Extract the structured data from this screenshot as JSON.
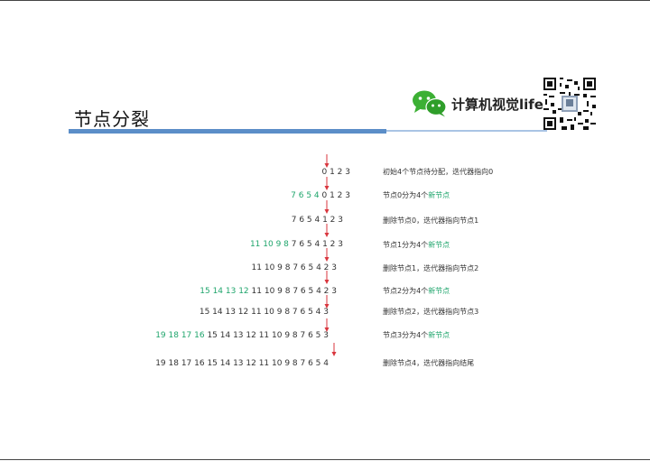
{
  "slide": {
    "title": "节点分裂",
    "brand": "计算机视觉life",
    "logo_icon": "wechat-icon",
    "qr_icon": "qr-code-icon",
    "accent_color": "#5b8ec8",
    "highlight_color": "#1fa56c"
  },
  "steps": [
    {
      "new": "",
      "rest": "0 1 2 3",
      "note": "初始4个节点待分配，迭代器指向0",
      "note_new": ""
    },
    {
      "new": "7 6 5 4 ",
      "rest": "0 1 2 3",
      "note": "节点0分为4个",
      "note_new": "新节点"
    },
    {
      "new": "",
      "rest": "7 6 5 4 1 2 3",
      "note": "删除节点0，迭代器指向节点1",
      "note_new": ""
    },
    {
      "new": "11 10 9 8 ",
      "rest": "7 6 5 4 1 2 3",
      "note": "节点1分为4个",
      "note_new": "新节点"
    },
    {
      "new": "",
      "rest": "11 10 9 8 7 6 5 4 2 3",
      "note": "删除节点1，迭代器指向节点2",
      "note_new": ""
    },
    {
      "new": "15 14 13 12 ",
      "rest": "11 10 9 8 7 6 5 4 2 3",
      "note": "节点2分为4个",
      "note_new": "新节点"
    },
    {
      "new": "",
      "rest": "15 14 13 12 11 10 9 8 7 6 5 4 3",
      "note": "删除节点2，迭代器指向节点3",
      "note_new": ""
    },
    {
      "new": "19 18 17 16 ",
      "rest": "15 14 13 12 11 10 9 8 7 6 5 3",
      "note": "节点3分为4个",
      "note_new": "新节点"
    },
    {
      "new": "",
      "rest": "19 18 17 16 15 14 13 12 11 10 9 8 7 6 5 4",
      "note": "删除节点4，迭代器指向结尾",
      "note_new": ""
    }
  ]
}
